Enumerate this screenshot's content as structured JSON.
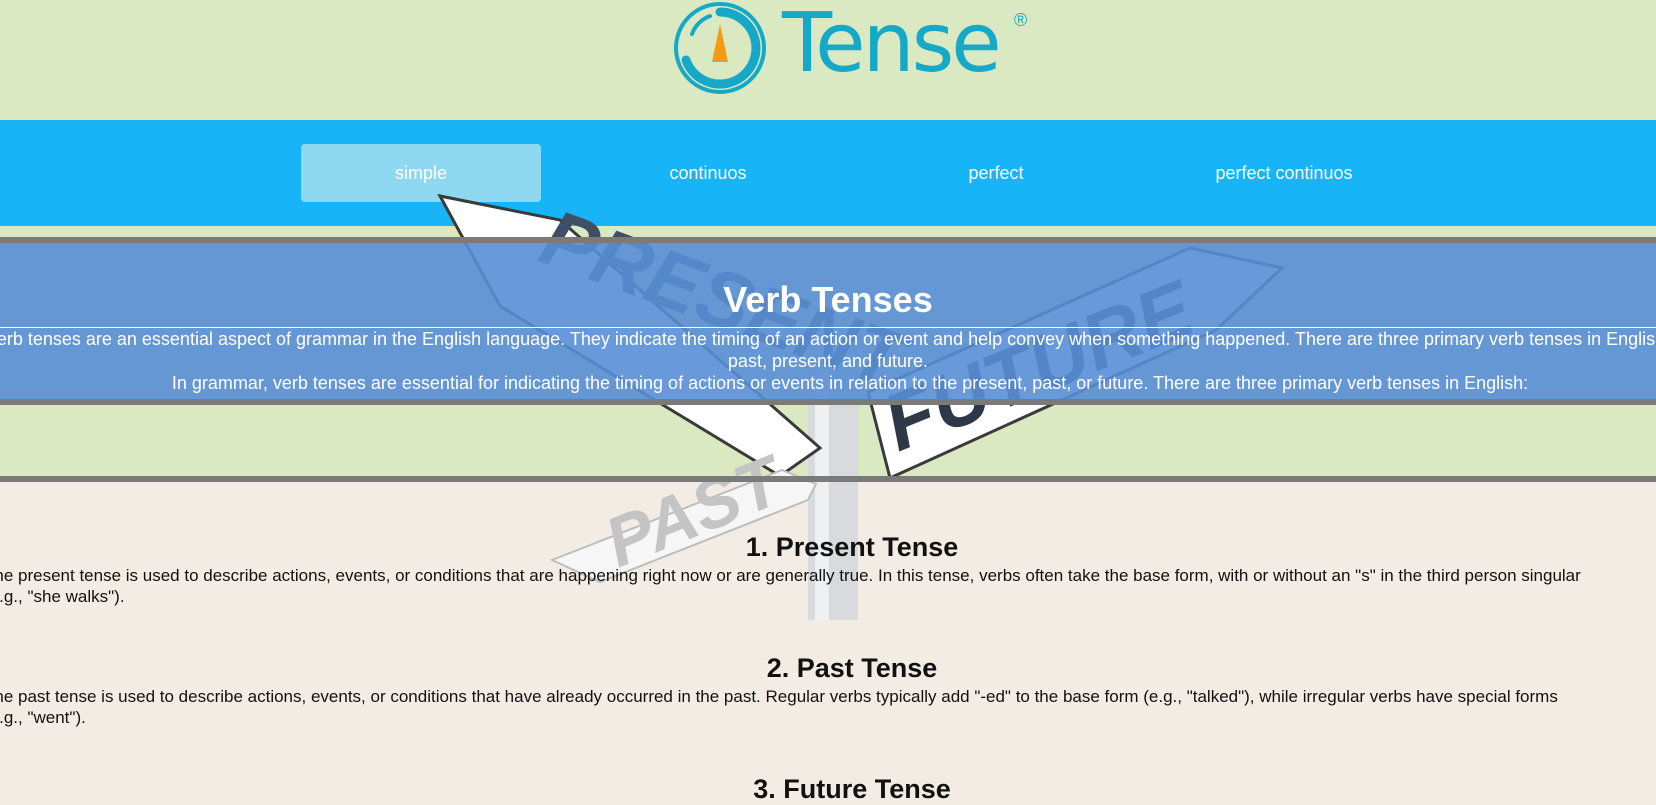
{
  "brand": {
    "name": "Tense",
    "registered_mark": "®",
    "colors": {
      "accent": "#16a8c7",
      "pointer": "#f39c12",
      "nav": "#17b5f8",
      "nav_active": "#8fd8f2",
      "hero": "#588ed6",
      "bg_green": "#dbe9c2",
      "bg_cream": "#f3ece5"
    }
  },
  "nav": {
    "items": [
      {
        "label": "simple",
        "active": true
      },
      {
        "label": "continuos",
        "active": false
      },
      {
        "label": "perfect",
        "active": false
      },
      {
        "label": "perfect continuos",
        "active": false
      }
    ]
  },
  "hero": {
    "title": "Verb Tenses",
    "paragraph1": "Verb tenses are an essential aspect of grammar in the English language. They indicate the timing of an action or event and help convey when something happened. There are three primary verb tenses in English: past, present, and future.",
    "paragraph2": "In grammar, verb tenses are essential for indicating the timing of actions or events in relation to the present, past, or future. There are three primary verb tenses in English:",
    "sign_labels": {
      "present": "PRESENT",
      "future": "FUTURE",
      "past": "PAST"
    }
  },
  "sections": [
    {
      "heading": "1. Present Tense",
      "line1": "The present tense is used to describe actions, events, or conditions that are happening right now or are generally true. In this tense, verbs often take the base form, with or without an \"s\" in the third person singular",
      "line2": "(e.g., \"she walks\")."
    },
    {
      "heading": "2. Past Tense",
      "line1": "The past tense is used to describe actions, events, or conditions that have already occurred in the past. Regular verbs typically add \"-ed\" to the base form (e.g., \"talked\"), while irregular verbs have special forms",
      "line2": "(e.g., \"went\")."
    },
    {
      "heading": "3. Future Tense"
    }
  ]
}
